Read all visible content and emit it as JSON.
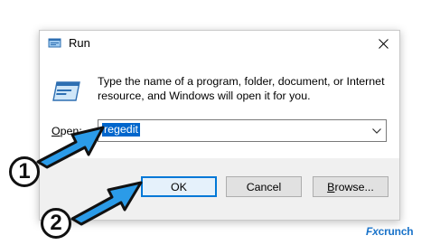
{
  "window": {
    "title": "Run",
    "close_icon": "close-icon",
    "title_icon": "run-app-icon"
  },
  "body": {
    "description": "Type the name of a program, folder, document, or Internet resource, and Windows will open it for you.",
    "open_label_prefix": "O",
    "open_label_rest": "pen:",
    "open_value": "regedit",
    "dropdown_icon": "chevron-down-icon"
  },
  "buttons": {
    "ok": "OK",
    "cancel": "Cancel",
    "browse_prefix": "B",
    "browse_rest": "rowse..."
  },
  "annotations": {
    "step1": "1",
    "step2": "2"
  },
  "watermark": {
    "brand_fx": "Fx",
    "brand_rest": "crunch"
  },
  "colors": {
    "arrow_fill": "#2b9be8",
    "selection": "#0066cc",
    "default_button_border": "#0078d7"
  }
}
